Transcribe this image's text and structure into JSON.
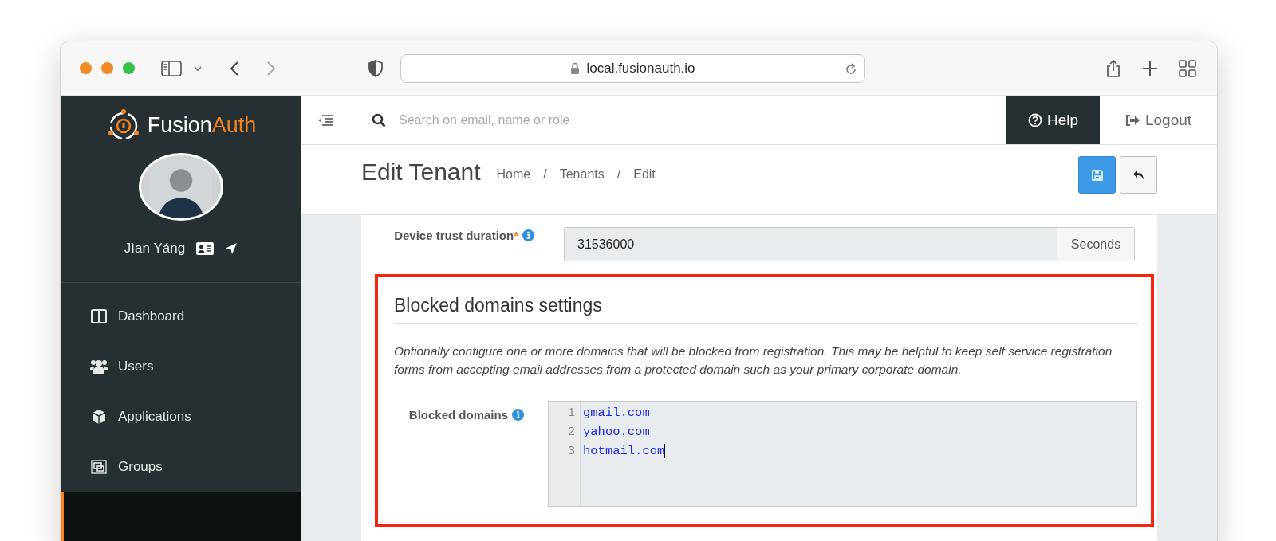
{
  "browser": {
    "url": "local.fusionauth.io"
  },
  "sidebar": {
    "logo": {
      "part_1": "Fusion",
      "part_2": "Auth"
    },
    "user_name": "Jìan Yáng",
    "items": [
      {
        "label": "Dashboard",
        "kind": "dashboard",
        "selected": false
      },
      {
        "label": "Users",
        "kind": "users",
        "selected": false
      },
      {
        "label": "Applications",
        "kind": "applications",
        "selected": false
      },
      {
        "label": "Groups",
        "kind": "groups",
        "selected": false
      },
      {
        "kind": "tenants",
        "selected": true
      }
    ]
  },
  "header": {
    "search_placeholder": "Search on email, name or role",
    "help": "Help",
    "logout": "Logout"
  },
  "page": {
    "title": "Edit Tenant",
    "separator": "/",
    "breadcrumbs": [
      "Home",
      "Tenants",
      "Edit"
    ]
  },
  "device_trust": {
    "label": "Device trust duration",
    "required_mark": "*",
    "value": "31536000",
    "unit": "Seconds"
  },
  "blocked_domains": {
    "heading": "Blocked domains settings",
    "description": "Optionally configure one or more domains that will be blocked from registration. This may be helpful to keep self service registration forms from accepting email addresses from a protected domain such as your primary corporate domain.",
    "label": "Blocked domains",
    "lines": [
      {
        "number": "1",
        "text": "gmail.com"
      },
      {
        "number": "2",
        "text": "yahoo.com"
      },
      {
        "number": "3",
        "text": "hotmail.com"
      }
    ]
  }
}
